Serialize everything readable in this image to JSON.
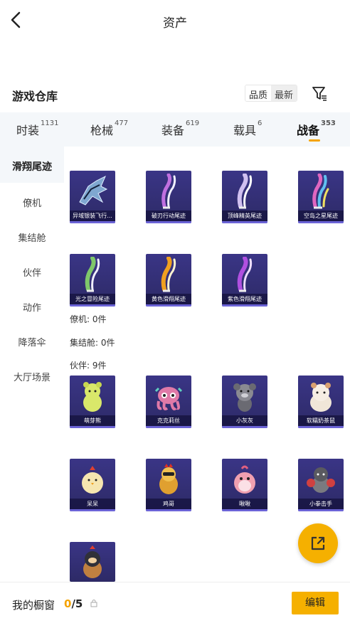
{
  "header": {
    "title": "资产"
  },
  "section": {
    "title": "游戏仓库",
    "sort_quality": "品质",
    "sort_newest": "最新"
  },
  "tabs": [
    {
      "label": "时装",
      "count": "1131"
    },
    {
      "label": "枪械",
      "count": "477"
    },
    {
      "label": "装备",
      "count": "619"
    },
    {
      "label": "载具",
      "count": "6"
    },
    {
      "label": "战备",
      "count": "353",
      "active": true
    }
  ],
  "sidebar": {
    "items": [
      "滑翔尾迹",
      "僚机",
      "集结舱",
      "伙伴",
      "动作",
      "降落伞",
      "大厅场景"
    ]
  },
  "grid": {
    "trails": [
      {
        "label": "异域银装飞行...",
        "color": "#9bc3e6"
      },
      {
        "label": "破刃行动尾迹",
        "color": "#c070e0"
      },
      {
        "label": "顶峰精英尾迹",
        "color": "#d0c0f0"
      },
      {
        "label": "空岛之星尾迹",
        "color": "#e066c0"
      },
      {
        "label": "光之冒险尾迹",
        "color": "#7fc86a"
      },
      {
        "label": "黄色滑翔尾迹",
        "color": "#f0a020"
      },
      {
        "label": "紫色滑翔尾迹",
        "color": "#b050e0"
      }
    ],
    "wingman_line": "僚机: 0件",
    "pod_line": "集结舱: 0件",
    "partner_line": "伙伴: 9件",
    "partners": [
      {
        "label": "萌芽熊",
        "color": "#d9e86a"
      },
      {
        "label": "克克莉丝",
        "color": "#e07aa8"
      },
      {
        "label": "小灰灰",
        "color": "#8a8a92"
      },
      {
        "label": "软糯奶茶鼠",
        "color": "#f0e6d8"
      },
      {
        "label": "呆呆",
        "color": "#f6e6b0"
      },
      {
        "label": "鸡哥",
        "color": "#e0a030"
      },
      {
        "label": "啾啾",
        "color": "#f0a0b0"
      },
      {
        "label": "小拳击手",
        "color": "#7a7a80"
      },
      {
        "label": "",
        "color": "#c08040"
      }
    ]
  },
  "footer": {
    "label": "我的橱窗",
    "count_current": "0",
    "count_total": "/5",
    "edit_label": "编辑"
  },
  "colors": {
    "accent": "#f5b000",
    "card_bg": "#2d2a66"
  }
}
